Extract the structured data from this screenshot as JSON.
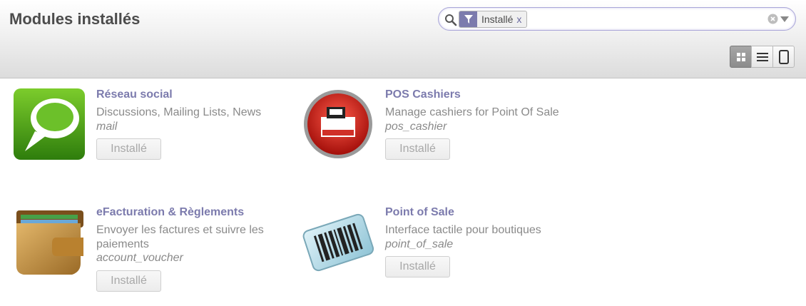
{
  "header": {
    "title": "Modules installés"
  },
  "search": {
    "facet_icon": "filter-icon",
    "facet_value": "Installé",
    "facet_remove": "x",
    "placeholder": ""
  },
  "view_switcher": [
    "kanban-view-icon",
    "list-view-icon",
    "form-view-icon"
  ],
  "modules": [
    {
      "title": "Réseau social",
      "summary": "Discussions, Mailing Lists, News",
      "technical_name": "mail",
      "state": "Installé",
      "icon": "chat-bubble-icon"
    },
    {
      "title": "POS Cashiers",
      "summary": "Manage cashiers for Point Of Sale",
      "technical_name": "pos_cashier",
      "state": "Installé",
      "icon": "cash-register-icon"
    },
    {
      "title": "eFacturation & Règlements",
      "summary": "Envoyer les factures et suivre les paiements",
      "technical_name": "account_voucher",
      "state": "Installé",
      "icon": "wallet-icon"
    },
    {
      "title": "Point of Sale",
      "summary": "Interface tactile pour boutiques",
      "technical_name": "point_of_sale",
      "state": "Installé",
      "icon": "barcode-icon"
    }
  ],
  "colors": {
    "accent": "#7c7bad",
    "muted_text": "#8a8a8a",
    "title_text": "#4c4c4c"
  }
}
